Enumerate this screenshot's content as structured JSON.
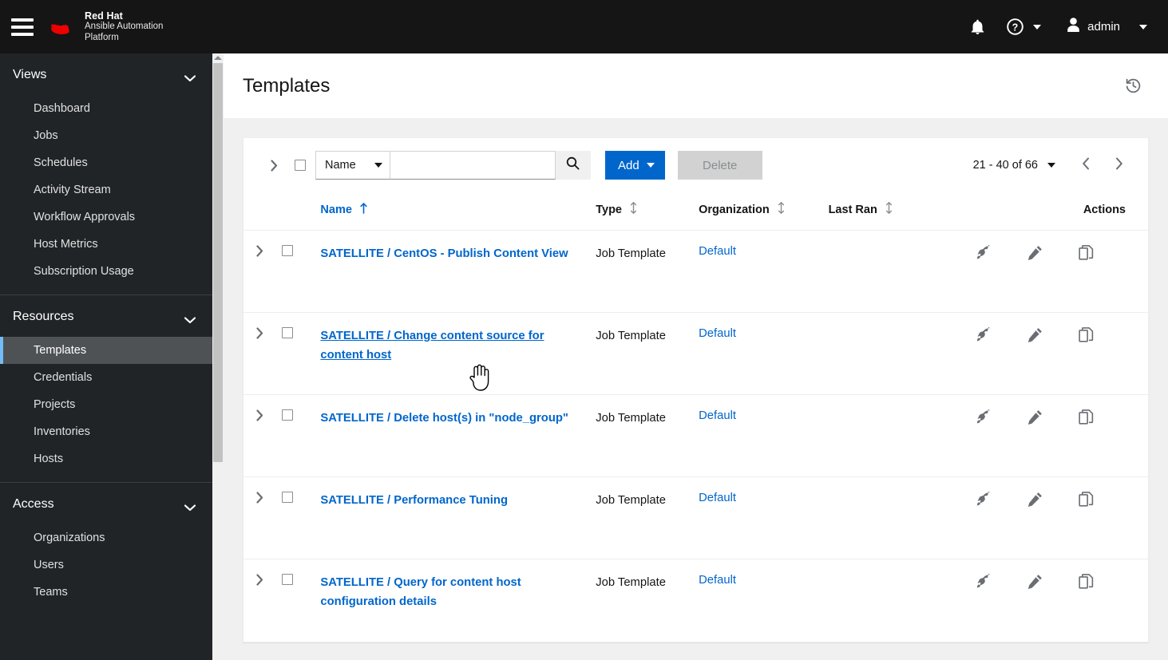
{
  "masthead": {
    "menu_icon": "hamburger-icon",
    "brand_line1": "Red Hat",
    "brand_line2": "Ansible Automation",
    "brand_line3": "Platform",
    "notifications_icon": "bell-icon",
    "help_icon": "question-circle-icon",
    "user_icon": "user-icon",
    "user_name": "admin"
  },
  "sidebar": {
    "sections": [
      {
        "title": "Views",
        "items": [
          {
            "label": "Dashboard",
            "active": false
          },
          {
            "label": "Jobs",
            "active": false
          },
          {
            "label": "Schedules",
            "active": false
          },
          {
            "label": "Activity Stream",
            "active": false
          },
          {
            "label": "Workflow Approvals",
            "active": false
          },
          {
            "label": "Host Metrics",
            "active": false
          },
          {
            "label": "Subscription Usage",
            "active": false
          }
        ]
      },
      {
        "title": "Resources",
        "items": [
          {
            "label": "Templates",
            "active": true
          },
          {
            "label": "Credentials",
            "active": false
          },
          {
            "label": "Projects",
            "active": false
          },
          {
            "label": "Inventories",
            "active": false
          },
          {
            "label": "Hosts",
            "active": false
          }
        ]
      },
      {
        "title": "Access",
        "items": [
          {
            "label": "Organizations",
            "active": false
          },
          {
            "label": "Users",
            "active": false
          },
          {
            "label": "Teams",
            "active": false
          }
        ]
      }
    ]
  },
  "page": {
    "title": "Templates",
    "history_icon": "history-icon"
  },
  "toolbar": {
    "expand_icon": "chevron-right-icon",
    "select_all_checkbox": "",
    "filter_select_value": "Name",
    "search_value": "",
    "search_placeholder": "",
    "search_icon": "search-icon",
    "add_label": "Add",
    "delete_label": "Delete",
    "pagination_text": "21 - 40 of 66",
    "prev_icon": "chevron-left-icon",
    "next_icon": "chevron-right-icon"
  },
  "table": {
    "columns": [
      {
        "label": "Name",
        "sort": "asc",
        "link": true
      },
      {
        "label": "Type",
        "sort": "none",
        "link": false
      },
      {
        "label": "Organization",
        "sort": "none",
        "link": false
      },
      {
        "label": "Last Ran",
        "sort": "none",
        "link": false
      },
      {
        "label": "Actions",
        "sort": null,
        "link": false
      }
    ],
    "rows": [
      {
        "name": "SATELLITE / CentOS - Publish Content View",
        "type": "Job Template",
        "organization": "Default",
        "last_ran": "",
        "hovered": false
      },
      {
        "name": "SATELLITE / Change content source for content host",
        "type": "Job Template",
        "organization": "Default",
        "last_ran": "",
        "hovered": true
      },
      {
        "name": "SATELLITE / Delete host(s) in \"node_group\"",
        "type": "Job Template",
        "organization": "Default",
        "last_ran": "",
        "hovered": false
      },
      {
        "name": "SATELLITE / Performance Tuning",
        "type": "Job Template",
        "organization": "Default",
        "last_ran": "",
        "hovered": false
      },
      {
        "name": "SATELLITE / Query for content host configuration details",
        "type": "Job Template",
        "organization": "Default",
        "last_ran": "",
        "hovered": false
      }
    ],
    "row_actions": [
      {
        "icon": "rocket-icon",
        "label": "Launch"
      },
      {
        "icon": "pencil-icon",
        "label": "Edit"
      },
      {
        "icon": "copy-icon",
        "label": "Copy"
      }
    ]
  },
  "colors": {
    "masthead_bg": "#151515",
    "sidebar_bg": "#212427",
    "active_item_bg": "#4f5255",
    "active_item_accent": "#73bcf7",
    "link": "#0066cc",
    "primary_button": "#0066cc",
    "brand_red": "#ee0000",
    "page_bg": "#f0f0f0"
  }
}
